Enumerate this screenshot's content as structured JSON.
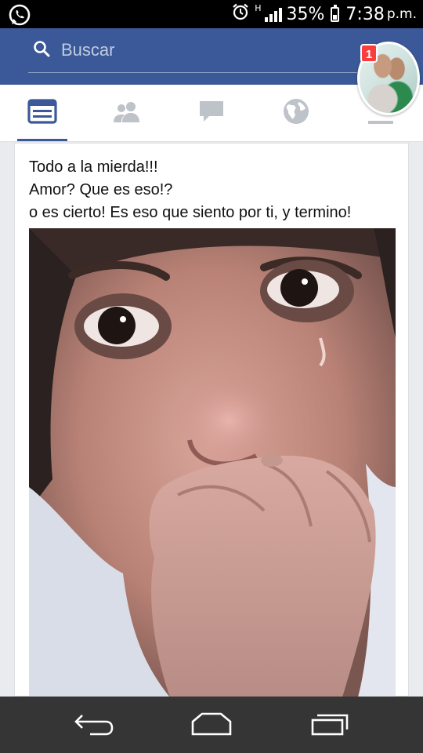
{
  "status_bar": {
    "left_icon": "whatsapp-icon",
    "alarm_icon": "alarm-clock-icon",
    "network_type": "H",
    "signal_icon": "signal-bars-icon",
    "battery_percent": "35%",
    "battery_icon": "battery-icon",
    "time": "7:38",
    "ampm": "p.m."
  },
  "header": {
    "search_placeholder": "Buscar",
    "search_icon": "search-icon",
    "brand_color": "#3b5998"
  },
  "tabs": [
    {
      "icon": "news-feed-icon",
      "active": true
    },
    {
      "icon": "friends-icon",
      "active": false
    },
    {
      "icon": "messages-icon",
      "active": false
    },
    {
      "icon": "globe-notifications-icon",
      "active": false
    },
    {
      "icon": "menu-icon",
      "active": false
    }
  ],
  "chat_head": {
    "badge_count": "1"
  },
  "post": {
    "lines": [
      "Todo a la mierda!!!",
      "Amor? Que es eso!?",
      "o es cierto! Es eso que siento por ti, y termino!"
    ],
    "photo": "photo of a crying young woman covering her mouth with her hand"
  },
  "nav_bar": {
    "back_icon": "back-icon",
    "home_icon": "home-icon",
    "recents_icon": "recent-apps-icon"
  }
}
